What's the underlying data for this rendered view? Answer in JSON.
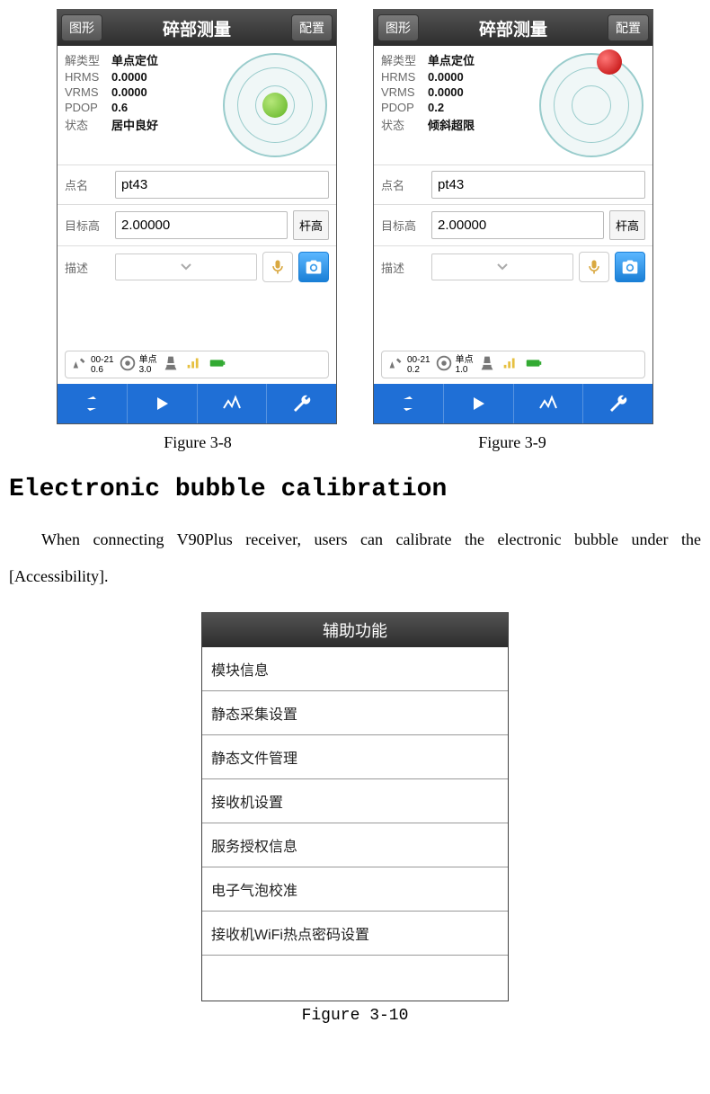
{
  "header": {
    "btn_left": "图形",
    "title": "碎部测量",
    "btn_right": "配置"
  },
  "info_labels": {
    "type": "解类型",
    "hrms": "HRMS",
    "vrms": "VRMS",
    "pdop": "PDOP",
    "status": "状态"
  },
  "field_labels": {
    "point": "点名",
    "target_height": "目标高",
    "unit": "杆高",
    "desc": "描述"
  },
  "screens": {
    "a": {
      "type": "单点定位",
      "hrms": "0.0000",
      "vrms": "0.0000",
      "pdop": "0.6",
      "status": "居中良好",
      "point": "pt43",
      "target_height": "2.00000",
      "sb1a": "00-21",
      "sb1b": "0.6",
      "sb2a": "单点",
      "sb2b": "3.0"
    },
    "b": {
      "type": "单点定位",
      "hrms": "0.0000",
      "vrms": "0.0000",
      "pdop": "0.2",
      "status": "倾斜超限",
      "point": "pt43",
      "target_height": "2.00000",
      "sb1a": "00-21",
      "sb1b": "0.2",
      "sb2a": "单点",
      "sb2b": "1.0"
    }
  },
  "captions": {
    "a": "Figure 3-8",
    "b": "Figure 3-9",
    "c": "Figure 3-10"
  },
  "section_title": "Electronic bubble calibration",
  "body_text": "When connecting V90Plus receiver,  users can calibrate the electronic bubble under the [Accessibility].",
  "aux": {
    "title": "辅助功能",
    "items": [
      "模块信息",
      "静态采集设置",
      "静态文件管理",
      "接收机设置",
      "服务授权信息",
      "电子气泡校准",
      "接收机WiFi热点密码设置"
    ]
  }
}
